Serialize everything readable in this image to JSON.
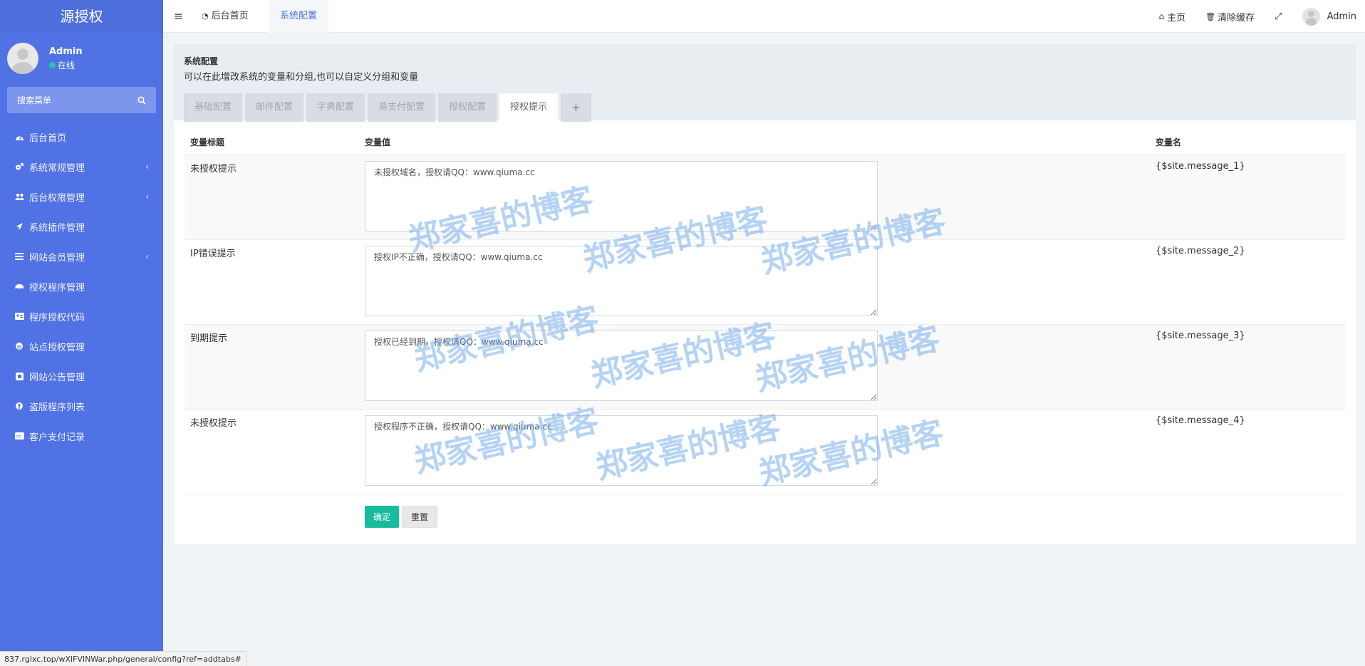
{
  "sidebar": {
    "logo": "源授权",
    "user": {
      "name": "Admin",
      "status": "在线"
    },
    "search_placeholder": "搜索菜单",
    "items": [
      {
        "label": "后台首页",
        "icon": "dashboard-icon",
        "has_children": false
      },
      {
        "label": "系统常规管理",
        "icon": "cogs-icon",
        "has_children": true
      },
      {
        "label": "后台权限管理",
        "icon": "users-icon",
        "has_children": true
      },
      {
        "label": "系统插件管理",
        "icon": "rocket-icon",
        "has_children": false
      },
      {
        "label": "网站会员管理",
        "icon": "list-icon",
        "has_children": true
      },
      {
        "label": "授权程序管理",
        "icon": "car-icon",
        "has_children": false
      },
      {
        "label": "程序授权代码",
        "icon": "id-card-icon",
        "has_children": false
      },
      {
        "label": "站点授权管理",
        "icon": "internet-explorer-icon",
        "has_children": false
      },
      {
        "label": "网站公告管理",
        "icon": "square-icon",
        "has_children": false
      },
      {
        "label": "盗版程序列表",
        "icon": "wrench-icon",
        "has_children": false
      },
      {
        "label": "客户支付记录",
        "icon": "cc-icon",
        "has_children": false
      }
    ]
  },
  "topbar": {
    "tabs": [
      {
        "label": "后台首页",
        "active": false
      },
      {
        "label": "系统配置",
        "active": true
      }
    ],
    "right": {
      "home": "主页",
      "clear_cache": "清除缓存",
      "user": "Admin"
    }
  },
  "panel": {
    "title": "系统配置",
    "description": "可以在此增改系统的变量和分组,也可以自定义分组和变量",
    "tabs": [
      "基础配置",
      "邮件配置",
      "字典配置",
      "易支付配置",
      "授权配置",
      "授权提示"
    ],
    "active_tab": "授权提示",
    "add_tab": "+",
    "columns": [
      "变量标题",
      "变量值",
      "变量名"
    ],
    "rows": [
      {
        "title": "未授权提示",
        "value": "未授权域名，授权请QQ：www.qiuma.cc",
        "name": "{$site.message_1}"
      },
      {
        "title": "IP错误提示",
        "value": "授权IP不正确，授权请QQ：www.qiuma.cc",
        "name": "{$site.message_2}"
      },
      {
        "title": "到期提示",
        "value": "授权已经到期，授权请QQ：www.qiuma.cc",
        "name": "{$site.message_3}"
      },
      {
        "title": "未授权提示",
        "value": "授权程序不正确，授权请QQ：www.qiuma.cc",
        "name": "{$site.message_4}"
      }
    ],
    "buttons": {
      "submit": "确定",
      "reset": "重置"
    }
  },
  "watermark": "郑家喜的博客",
  "status_url": "837.rglxc.top/wXlFVINWar.php/general/config?ref=addtabs#",
  "colors": {
    "sidebar": "#5072e4",
    "accent": "#4e73df",
    "success": "#18bc9c",
    "online": "#1ec8a5"
  }
}
